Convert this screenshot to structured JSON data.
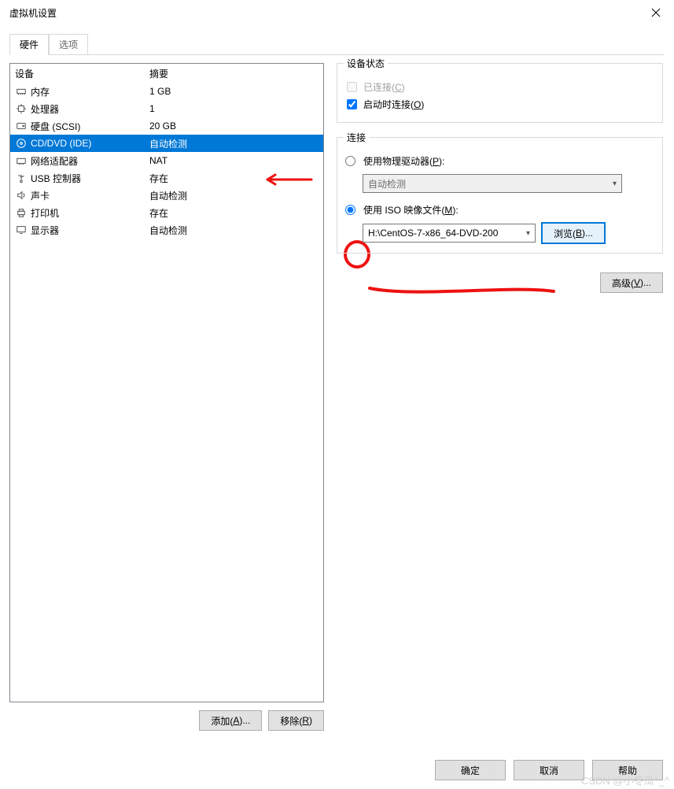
{
  "titlebar": {
    "title": "虚拟机设置"
  },
  "tabs": {
    "hardware": "硬件",
    "options": "选项"
  },
  "device_headers": {
    "device": "设备",
    "summary": "摘要"
  },
  "devices": [
    {
      "icon": "memory-icon",
      "name": "内存",
      "summary": "1 GB"
    },
    {
      "icon": "cpu-icon",
      "name": "处理器",
      "summary": "1"
    },
    {
      "icon": "disk-icon",
      "name": "硬盘 (SCSI)",
      "summary": "20 GB"
    },
    {
      "icon": "cd-icon",
      "name": "CD/DVD (IDE)",
      "summary": "自动检测"
    },
    {
      "icon": "nic-icon",
      "name": "网络适配器",
      "summary": "NAT"
    },
    {
      "icon": "usb-icon",
      "name": "USB 控制器",
      "summary": "存在"
    },
    {
      "icon": "sound-icon",
      "name": "声卡",
      "summary": "自动检测"
    },
    {
      "icon": "printer-icon",
      "name": "打印机",
      "summary": "存在"
    },
    {
      "icon": "display-icon",
      "name": "显示器",
      "summary": "自动检测"
    }
  ],
  "left_buttons": {
    "add_prefix": "添加(",
    "add_ul": "A",
    "add_suffix": ")...",
    "remove_prefix": "移除(",
    "remove_ul": "R",
    "remove_suffix": ")"
  },
  "right": {
    "status_title": "设备状态",
    "connected_prefix": "已连接(",
    "connected_ul": "C",
    "connected_suffix": ")",
    "connect_poweron_prefix": "启动时连接(",
    "connect_poweron_ul": "O",
    "connect_poweron_suffix": ")",
    "connection_title": "连接",
    "use_phys_prefix": "使用物理驱动器(",
    "use_phys_ul": "P",
    "use_phys_suffix": "):",
    "phys_value": "自动检测",
    "use_iso_prefix": "使用 ISO 映像文件(",
    "use_iso_ul": "M",
    "use_iso_suffix": "):",
    "iso_path": "H:\\CentOS-7-x86_64-DVD-200",
    "browse_prefix": "浏览(",
    "browse_ul": "B",
    "browse_suffix": ")...",
    "advanced_prefix": "高级(",
    "advanced_ul": "V",
    "advanced_suffix": ")..."
  },
  "dialog_buttons": {
    "ok": "确定",
    "cancel": "取消",
    "help": "帮助"
  },
  "watermark": "CSDN @小冬瓜^_^"
}
